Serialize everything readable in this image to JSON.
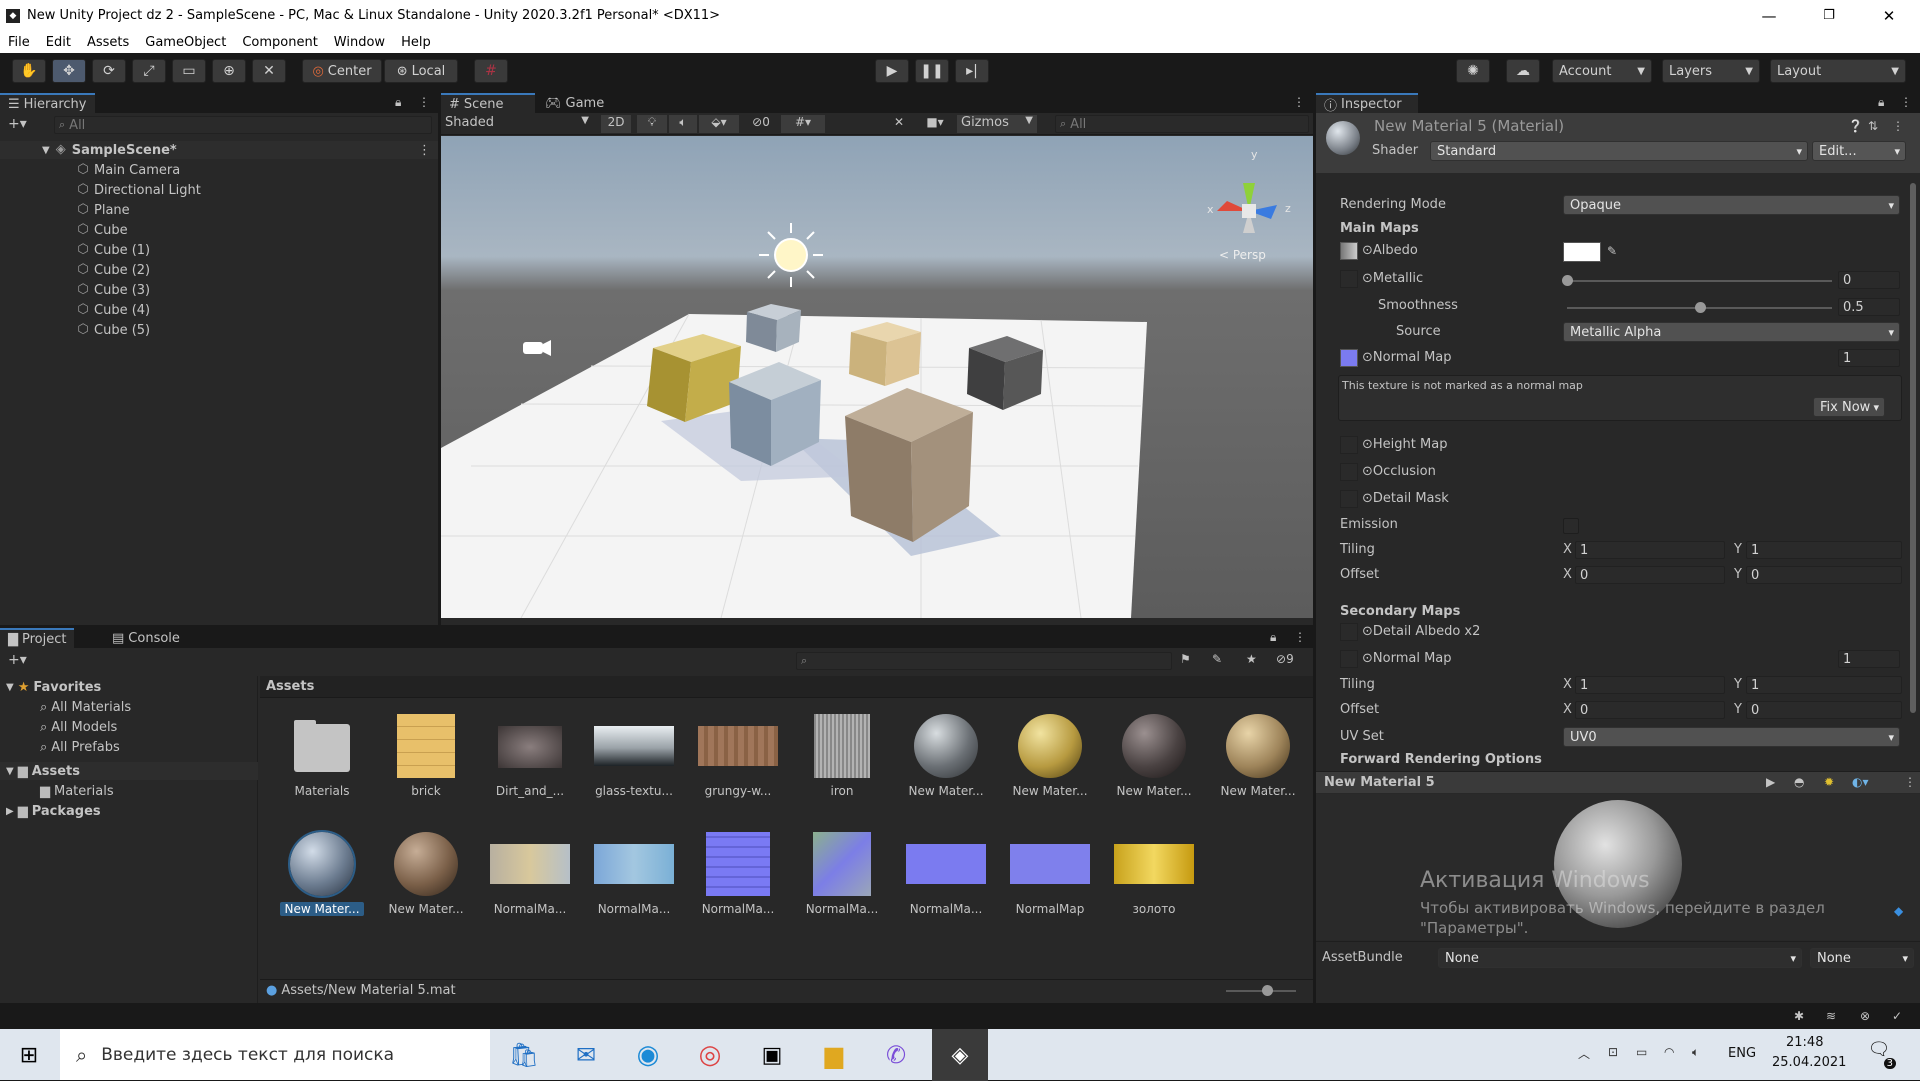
{
  "window": {
    "title": "New Unity Project dz 2 - SampleScene - PC, Mac & Linux Standalone - Unity 2020.3.2f1 Personal* <DX11>",
    "min": "—",
    "max": "❐",
    "close": "✕"
  },
  "menu": [
    "File",
    "Edit",
    "Assets",
    "GameObject",
    "Component",
    "Window",
    "Help"
  ],
  "toolbar": {
    "center": "Center",
    "local": "Local",
    "account": "Account",
    "layers": "Layers",
    "layout": "Layout"
  },
  "hierarchy": {
    "tab": "Hierarchy",
    "search_placeholder": "All",
    "scene": "SampleScene*",
    "items": [
      "Main Camera",
      "Directional Light",
      "Plane",
      "Cube",
      "Cube (1)",
      "Cube (2)",
      "Cube (3)",
      "Cube (4)",
      "Cube (5)"
    ]
  },
  "scene": {
    "tab_scene": "Scene",
    "tab_game": "Game",
    "shading": "Shaded",
    "mode2d": "2D",
    "hidden_count": "0",
    "gizmos": "Gizmos",
    "search_placeholder": "All",
    "persp": "< Persp",
    "axis_x": "x",
    "axis_y": "y",
    "axis_z": "z"
  },
  "project": {
    "tab_project": "Project",
    "tab_console": "Console",
    "hidden_count": "9",
    "favorites": "Favorites",
    "fav_items": [
      "All Materials",
      "All Models",
      "All Prefabs"
    ],
    "assets": "Assets",
    "assets_children": [
      "Materials"
    ],
    "packages": "Packages",
    "breadcrumb": "Assets",
    "grid_row1": [
      "Materials",
      "brick",
      "Dirt_and_...",
      "glass-textu...",
      "grungy-w...",
      "iron",
      "New Mater...",
      "New Mater...",
      "New Mater...",
      "New Mater..."
    ],
    "grid_row2": [
      "New Mater...",
      "New Mater...",
      "NormalMa...",
      "NormalMa...",
      "NormalMa...",
      "NormalMa...",
      "NormalMa...",
      "NormalMap",
      "золото"
    ],
    "footer_path": "Assets/New Material 5.mat"
  },
  "inspector": {
    "tab": "Inspector",
    "title": "New Material 5 (Material)",
    "shader_label": "Shader",
    "shader": "Standard",
    "edit": "Edit...",
    "rendering_mode_label": "Rendering Mode",
    "rendering_mode": "Opaque",
    "main_maps": "Main Maps",
    "albedo": "Albedo",
    "metallic": "Metallic",
    "metallic_value": "0",
    "metallic_fraction": 0,
    "smoothness": "Smoothness",
    "smoothness_value": "0.5",
    "smoothness_fraction": 0.5,
    "source_label": "Source",
    "source": "Metallic Alpha",
    "normal_map": "Normal Map",
    "normal_value": "1",
    "warning": "This texture is not marked as a normal map",
    "fix_now": "Fix Now",
    "height_map": "Height Map",
    "occlusion": "Occlusion",
    "detail_mask": "Detail Mask",
    "emission": "Emission",
    "tiling": "Tiling",
    "offset": "Offset",
    "x": "X",
    "y": "Y",
    "tiling_x": "1",
    "tiling_y": "1",
    "offset_x": "0",
    "offset_y": "0",
    "secondary_maps": "Secondary Maps",
    "detail_albedo": "Detail Albedo x2",
    "normal_map2": "Normal Map",
    "normal2_value": "1",
    "tiling2_x": "1",
    "tiling2_y": "1",
    "offset2_x": "0",
    "offset2_y": "0",
    "uv_set_label": "UV Set",
    "uv_set": "UV0",
    "forward": "Forward Rendering Options",
    "preview_title": "New Material 5",
    "watermark1": "Активация Windows",
    "watermark2": "Чтобы активировать Windows, перейдите в раздел \"Параметры\".",
    "assetbundle_label": "AssetBundle",
    "assetbundle": "None",
    "variant": "None"
  },
  "taskbar": {
    "search": "Введите здесь текст для поиска",
    "lang": "ENG",
    "time": "21:48",
    "date": "25.04.2021",
    "notif": "3"
  },
  "colors": {
    "accent": "#3a79bb",
    "bg": "#282828",
    "dark": "#191919",
    "selection": "#2c5d87",
    "normal_map": "#7b7bf0"
  }
}
